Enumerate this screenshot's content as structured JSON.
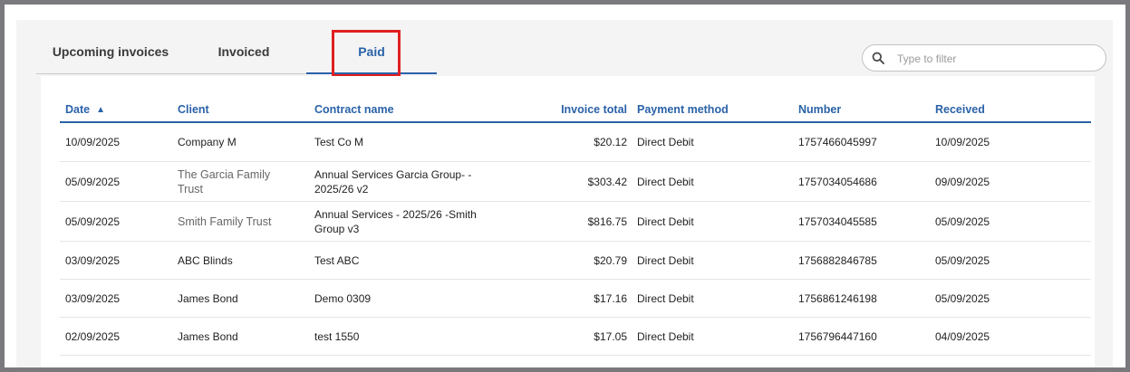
{
  "tabs": {
    "upcoming": "Upcoming invoices",
    "invoiced": "Invoiced",
    "paid": "Paid"
  },
  "search": {
    "placeholder": "Type to filter",
    "value": ""
  },
  "icons": {
    "search": "search-icon",
    "sort": "sort-ascending-icon"
  },
  "colors": {
    "accent": "#2a62a8",
    "highlight": "#e02020",
    "frame": "#7a7a7e"
  },
  "table": {
    "sort": {
      "column": "Date",
      "direction": "ascending"
    },
    "headers": {
      "date": "Date",
      "client": "Client",
      "contract": "Contract name",
      "total": "Invoice total",
      "payment": "Payment method",
      "number": "Number",
      "received": "Received"
    },
    "rows": [
      {
        "date": "10/09/2025",
        "client": "Company M",
        "contract": "Test Co M",
        "total": "$20.12",
        "payment": "Direct Debit",
        "number": "1757466045997",
        "received": "10/09/2025"
      },
      {
        "date": "05/09/2025",
        "client": "The Garcia Family Trust",
        "contract": "Annual Services Garcia Group- - 2025/26 v2",
        "total": "$303.42",
        "payment": "Direct Debit",
        "number": "1757034054686",
        "received": "09/09/2025"
      },
      {
        "date": "05/09/2025",
        "client": "Smith Family Trust",
        "contract": "Annual Services - 2025/26 -Smith Group v3",
        "total": "$816.75",
        "payment": "Direct Debit",
        "number": "1757034045585",
        "received": "05/09/2025"
      },
      {
        "date": "03/09/2025",
        "client": "ABC Blinds",
        "contract": "Test ABC",
        "total": "$20.79",
        "payment": "Direct Debit",
        "number": "1756882846785",
        "received": "05/09/2025"
      },
      {
        "date": "03/09/2025",
        "client": "James Bond",
        "contract": "Demo 0309",
        "total": "$17.16",
        "payment": "Direct Debit",
        "number": "1756861246198",
        "received": "05/09/2025"
      },
      {
        "date": "02/09/2025",
        "client": "James Bond",
        "contract": "test 1550",
        "total": "$17.05",
        "payment": "Direct Debit",
        "number": "1756796447160",
        "received": "04/09/2025"
      }
    ]
  }
}
